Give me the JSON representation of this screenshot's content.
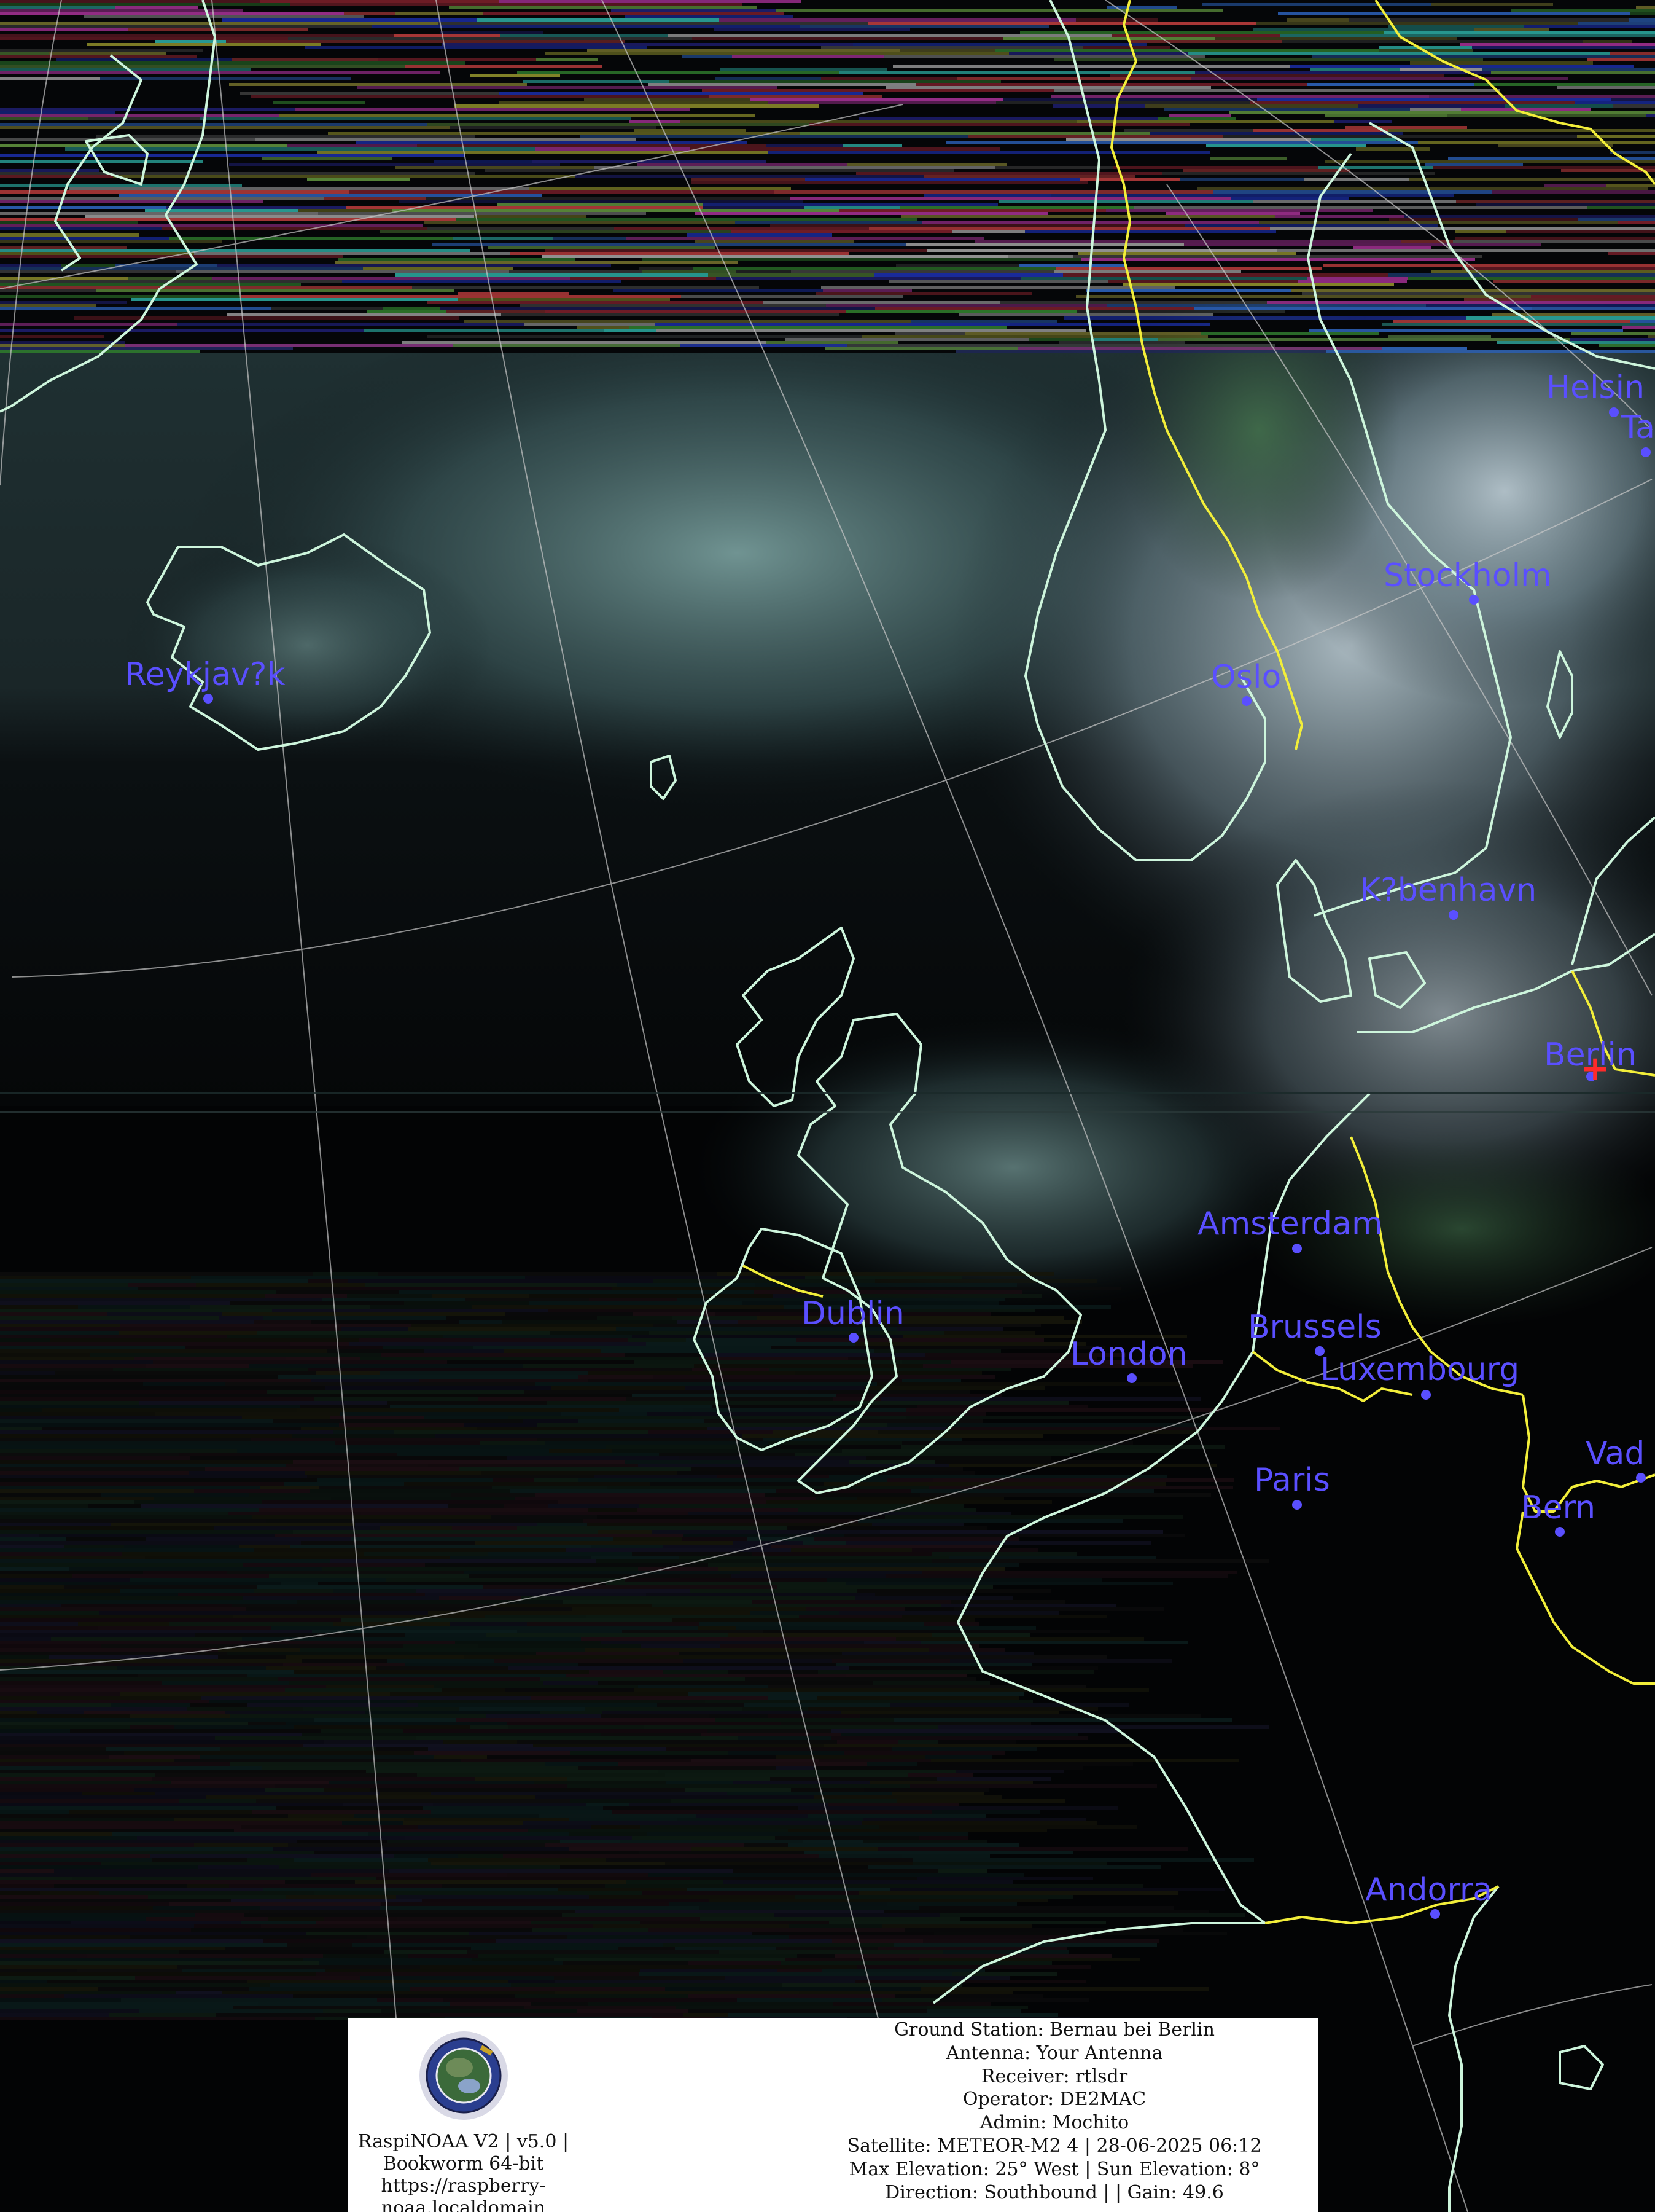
{
  "map": {
    "cities": [
      {
        "name": "Helsin",
        "label_id": "city-helsinki"
      },
      {
        "name": "Tall",
        "label_id": "city-tallinn"
      },
      {
        "name": "Stockholm",
        "label_id": "city-stockholm"
      },
      {
        "name": "Reykjav?k",
        "label_id": "city-reykjavik"
      },
      {
        "name": "Oslo",
        "label_id": "city-oslo"
      },
      {
        "name": "K?benhavn",
        "label_id": "city-kobenhavn"
      },
      {
        "name": "Berlin",
        "label_id": "city-berlin"
      },
      {
        "name": "Amsterdam",
        "label_id": "city-amsterdam"
      },
      {
        "name": "Dublin",
        "label_id": "city-dublin"
      },
      {
        "name": "Brussels",
        "label_id": "city-brussels"
      },
      {
        "name": "London",
        "label_id": "city-london"
      },
      {
        "name": "Luxembourg",
        "label_id": "city-luxembourg"
      },
      {
        "name": "Vad",
        "label_id": "city-vaduz"
      },
      {
        "name": "Paris",
        "label_id": "city-paris"
      },
      {
        "name": "Bern",
        "label_id": "city-bern"
      },
      {
        "name": "Andorra",
        "label_id": "city-andorra"
      }
    ],
    "colors": {
      "city_label": "#5a4fff",
      "coastline": "#cdf5dc",
      "border": "#f2ee3a",
      "graticule": "#c8c8c8",
      "ground_station_marker": "#ff2a2a"
    }
  },
  "info": {
    "app_name": "RaspiNOAA V2 | v5.0 |",
    "os": "Bookworm 64-bit",
    "url_line1": "https://raspberry-",
    "url_line2": "noaa.localdomain",
    "lines": [
      "Ground Station: Bernau bei Berlin",
      "Antenna: Your Antenna",
      "Receiver: rtlsdr",
      "Operator: DE2MAC",
      "Admin: Mochito",
      "Satellite: METEOR-M2 4 | 28-06-2025 06:12",
      "Max Elevation: 25° West | Sun Elevation: 8°",
      "Direction: Southbound | | Gain: 49.6"
    ]
  }
}
